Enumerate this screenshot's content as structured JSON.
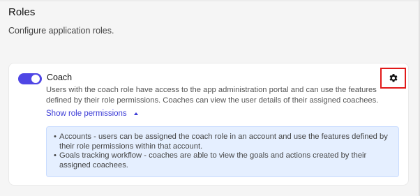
{
  "page": {
    "title": "Roles",
    "subtitle": "Configure application roles."
  },
  "role": {
    "name": "Coach",
    "enabled": true,
    "description": "Users with the coach role have access to the app administration portal and can use the features defined by their role permissions. Coaches can view the user details of their assigned coachees.",
    "toggle_permissions_label": "Show role permissions",
    "permissions": [
      "Accounts - users can be assigned the coach role in an account and use the features defined by their role permissions within that account.",
      "Goals tracking workflow - coaches are able to view the goals and actions created by their assigned coachees."
    ]
  },
  "colors": {
    "accent": "#4f46e5",
    "link": "#3b3bd6",
    "highlight_border": "#e11919",
    "info_background": "#e5efff"
  },
  "icons": {
    "settings": "gear-icon",
    "expand": "chevron-up-icon"
  }
}
